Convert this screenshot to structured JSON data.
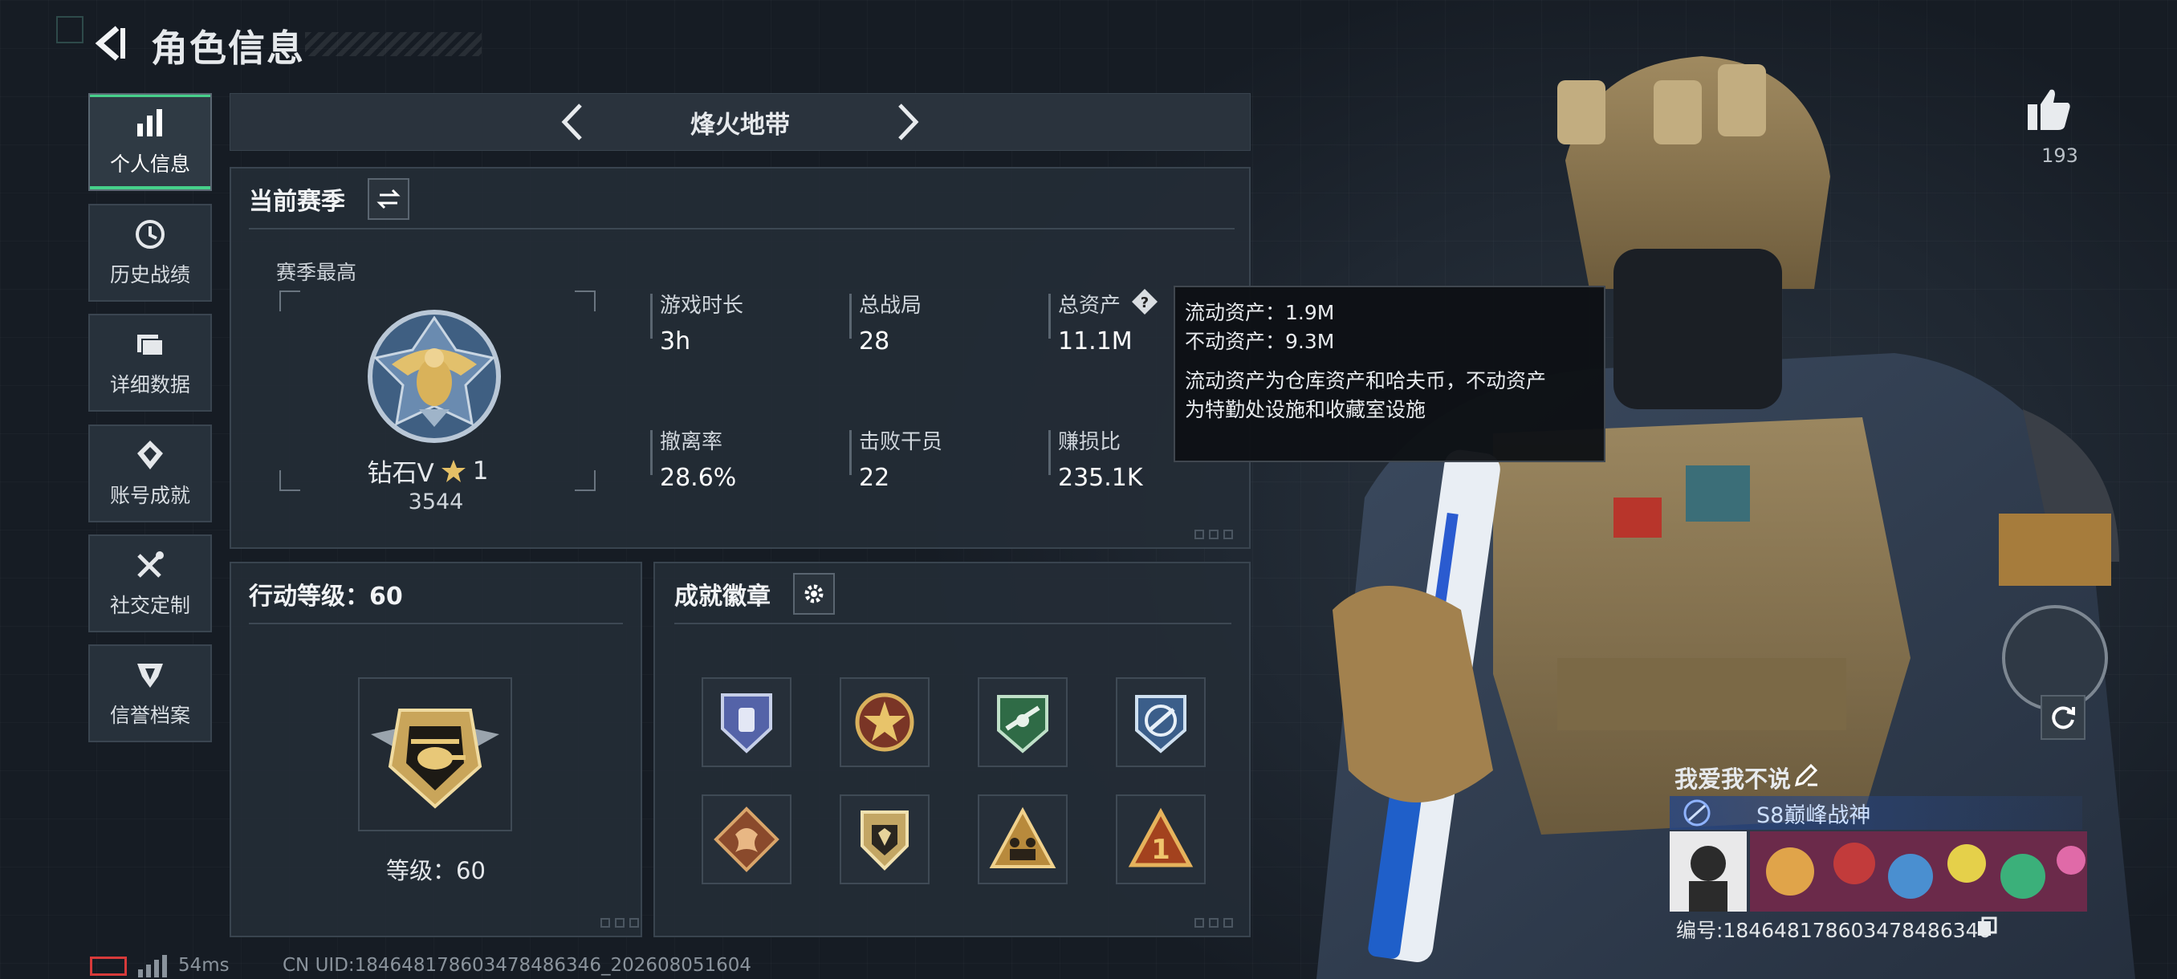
{
  "header": {
    "title": "角色信息"
  },
  "sidebar": {
    "items": [
      {
        "label": "个人信息",
        "icon": "bar-chart-icon",
        "active": true
      },
      {
        "label": "历史战绩",
        "icon": "clock-history-icon",
        "active": false
      },
      {
        "label": "详细数据",
        "icon": "folder-icon",
        "active": false
      },
      {
        "label": "账号成就",
        "icon": "achievement-icon",
        "active": false
      },
      {
        "label": "社交定制",
        "icon": "tools-icon",
        "active": false
      },
      {
        "label": "信誉档案",
        "icon": "reputation-icon",
        "active": false
      }
    ]
  },
  "mode": {
    "name": "烽火地带"
  },
  "season": {
    "heading": "当前赛季",
    "best_label": "赛季最高",
    "rank_name": "钻石V",
    "rank_stars": "1",
    "rank_score": "3544",
    "stats": [
      {
        "label": "游戏时长",
        "value": "3h"
      },
      {
        "label": "总战局",
        "value": "28"
      },
      {
        "label": "总资产",
        "value": "11.1M"
      },
      {
        "label": "撤离率",
        "value": "28.6%"
      },
      {
        "label": "击败干员",
        "value": "22"
      },
      {
        "label": "赚损比",
        "value": "235.1K"
      }
    ]
  },
  "tooltip": {
    "liquid": "流动资产：1.9M",
    "fixed": "不动资产：9.3M",
    "desc_line1": "流动资产为仓库资产和哈夫币，不动资产",
    "desc_line2": "为特勤处设施和收藏室设施"
  },
  "action_level": {
    "heading": "行动等级：60",
    "level_text": "等级：60"
  },
  "badges": {
    "heading": "成就徽章",
    "items": [
      "blue-shield-badge-icon",
      "star-shield-badge-icon",
      "green-aircraft-badge-icon",
      "blue-aircraft-badge-icon",
      "dragon-badge-icon",
      "gold-shield-badge-icon",
      "soldiers-triangle-badge-icon",
      "triangle-one-badge-icon"
    ]
  },
  "player": {
    "likes": "193",
    "nickname": "我爱我不说",
    "title": "S8巅峰战神",
    "uid_line": "编号:1846481786034784863​46"
  },
  "footer": {
    "ping": "54ms",
    "uid": "CN UID:1846481786034784863​46_202608051604"
  },
  "colors": {
    "accent": "#46d08a",
    "panel": "#242c36",
    "background": "#1f2731"
  }
}
